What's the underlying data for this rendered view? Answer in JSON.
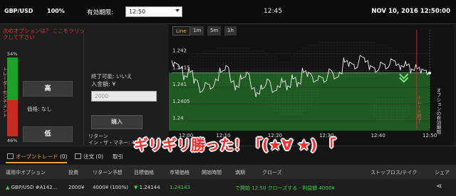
{
  "topbar": {
    "pair": "GBP/USD",
    "payout_pct": "100%",
    "expiry_label": "有効期限:",
    "expiry_value": "12:50",
    "current_time": "12:45",
    "datetime": "NOV 10, 2016 12:50:00"
  },
  "left": {
    "next_option_link": "次のオプションは？ ここをクリックして下さい",
    "sentiment_label": "トレーダーセンチメント",
    "sentiment_high_pct": "54%",
    "sentiment_low_pct": "46%",
    "sentiment_high_fraction": 0.54,
    "high_button": "高",
    "price_text": "価格: なし",
    "low_button": "低",
    "close_possible": "終了可能: いいえ",
    "amount_label": "入金額: ¥",
    "amount_placeholder": "2000",
    "buy_button": "購入",
    "return_label": "リターン",
    "itm_label": "イン・ザ・マネー: 4000¥ (100%)"
  },
  "chart_data": {
    "type": "line",
    "timeframes": [
      "Line",
      "1m",
      "5m",
      "1h"
    ],
    "active_timeframe": "Line",
    "x_ticks": [
      "12:00",
      "12:10",
      "12:20",
      "12:30",
      "12:40",
      "12:50"
    ],
    "y_ticks": [
      "1.242",
      "1.2415",
      "1.241",
      "1.2405",
      "1.24"
    ],
    "ylim": [
      1.2398,
      1.2425
    ],
    "strike_price": 1.24144,
    "expiry_marker_label": "オプションの有効期限",
    "trade_end_label": "トレード終了",
    "x_minutes": [
      0,
      1,
      2,
      3,
      4,
      5,
      6,
      7,
      8,
      9,
      10,
      11,
      12,
      13,
      14,
      15,
      16,
      17,
      18,
      19,
      20,
      21,
      22,
      23,
      24,
      25,
      26,
      27,
      28,
      29,
      30,
      31,
      32,
      33,
      34,
      35,
      36,
      37,
      38,
      39,
      40,
      41,
      42,
      43,
      44,
      45,
      46,
      47,
      48,
      49,
      50
    ],
    "values": [
      1.2418,
      1.2417,
      1.2416,
      1.2413,
      1.2415,
      1.2412,
      1.2409,
      1.2411,
      1.241,
      1.2412,
      1.2415,
      1.2416,
      1.2412,
      1.241,
      1.2413,
      1.2414,
      1.241,
      1.2408,
      1.241,
      1.2412,
      1.2409,
      1.241,
      1.2412,
      1.241,
      1.2413,
      1.2411,
      1.2415,
      1.2414,
      1.2412,
      1.2413,
      1.2412,
      1.2415,
      1.2413,
      1.2414,
      1.2418,
      1.2417,
      1.2416,
      1.2419,
      1.2418,
      1.2416,
      1.2415,
      1.2417,
      1.2416,
      1.2418,
      1.2417,
      1.2416,
      1.2417,
      1.2415,
      1.2416,
      1.2415,
      1.24143
    ]
  },
  "tabs": [
    {
      "label": "オープントレード",
      "count": "(0)"
    },
    {
      "label": "注文",
      "count": "(0)"
    },
    {
      "label": "取引"
    }
  ],
  "table": {
    "headers": [
      "運用中オプション",
      "投資",
      "リターン予想",
      "目標価格",
      "市場価格",
      "開始時間",
      "満期",
      "クローズ",
      "ストップロス/テイク",
      "シェア"
    ],
    "row": {
      "option": "GBP/USD #A142...",
      "invest": "2000¥",
      "expected_return": "4000¥ (100%)",
      "target_price": "1.24144",
      "market_price": "1.24143",
      "start_time": "",
      "expiry": "",
      "close": "で開始 12:50    クローズする - 利益額 4000¥"
    }
  },
  "caption": "ギリギリ勝った！「(★∀ ★) 「"
}
